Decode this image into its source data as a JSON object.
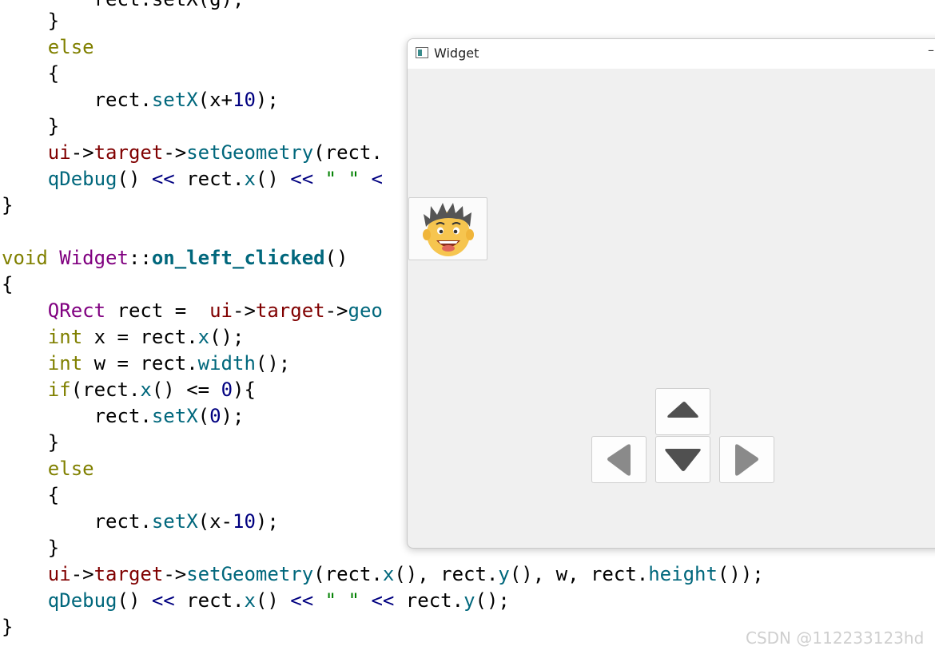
{
  "code_lines": {
    "l01": {
      "a": "        rect.setX(g);"
    },
    "l02": {
      "a": "    }"
    },
    "l03": {
      "a": "    ",
      "kw": "else"
    },
    "l04": {
      "a": "    {"
    },
    "l05": {
      "a": "        rect.",
      "fn": "setX",
      "b": "(x+",
      "num": "10",
      "c": ");"
    },
    "l06": {
      "a": "    }"
    },
    "l07": {
      "a": "    ",
      "p1": "ui",
      "b": "->",
      "p2": "target",
      "c": "->",
      "fn": "setGeometry",
      "d": "(rect."
    },
    "l08": {
      "a": "    ",
      "fn": "qDebug",
      "b": "() ",
      "op1": "<<",
      "c": " rect.",
      "fn2": "x",
      "d": "() ",
      "op2": "<<",
      "e": " ",
      "str": "\" \"",
      "f": " <"
    },
    "l09": {
      "a": "}"
    },
    "l10": {
      "kw": "void",
      "a": " ",
      "ty": "Widget",
      "b": "::",
      "fnb": "on_left_clicked",
      "c": "()"
    },
    "l11": {
      "a": "{"
    },
    "l12": {
      "a": "    ",
      "ty": "QRect",
      "b": " rect =  ",
      "p1": "ui",
      "c": "->",
      "p2": "target",
      "d": "->",
      "fn": "geo"
    },
    "l13": {
      "a": "    ",
      "kw": "int",
      "b": " x = rect.",
      "fn": "x",
      "c": "();"
    },
    "l14": {
      "a": "    ",
      "kw": "int",
      "b": " w = rect.",
      "fn": "width",
      "c": "();"
    },
    "l15": {
      "a": "    ",
      "kw": "if",
      "b": "(rect.",
      "fn": "x",
      "c": "() <= ",
      "num": "0",
      "d": "){"
    },
    "l16": {
      "a": "        rect.",
      "fn": "setX",
      "b": "(",
      "num": "0",
      "c": ");"
    },
    "l17": {
      "a": "    }"
    },
    "l18": {
      "a": "    ",
      "kw": "else"
    },
    "l19": {
      "a": "    {"
    },
    "l20": {
      "a": "        rect.",
      "fn": "setX",
      "b": "(x-",
      "num": "10",
      "c": ");"
    },
    "l21": {
      "a": "    }"
    },
    "l22": {
      "a": "    ",
      "p1": "ui",
      "b": "->",
      "p2": "target",
      "c": "->",
      "fn": "setGeometry",
      "d": "(rect.",
      "fn2": "x",
      "e": "(), rect.",
      "fn3": "y",
      "f": "(), w, rect.",
      "fn4": "height",
      "g": "());"
    },
    "l23": {
      "a": "    ",
      "fn": "qDebug",
      "b": "() ",
      "op1": "<<",
      "c": " rect.",
      "fn2": "x",
      "d": "() ",
      "op2": "<<",
      "e": " ",
      "str": "\" \"",
      "f": " ",
      "op3": "<<",
      "g": " rect.",
      "fn3": "y",
      "h": "();"
    },
    "l24": {
      "a": "}"
    }
  },
  "window": {
    "title": "Widget",
    "minimize_glyph": "–",
    "target_icon": "cartoon-face-icon",
    "buttons": {
      "up": "triangle-up-icon",
      "down": "triangle-down-icon",
      "left": "triangle-left-icon",
      "right": "triangle-right-icon"
    }
  },
  "watermark": "CSDN @112233123hd",
  "colors": {
    "keyword": "#808000",
    "type": "#800080",
    "function": "#00677c",
    "pointer": "#800000",
    "number": "#000080",
    "string": "#008000"
  }
}
